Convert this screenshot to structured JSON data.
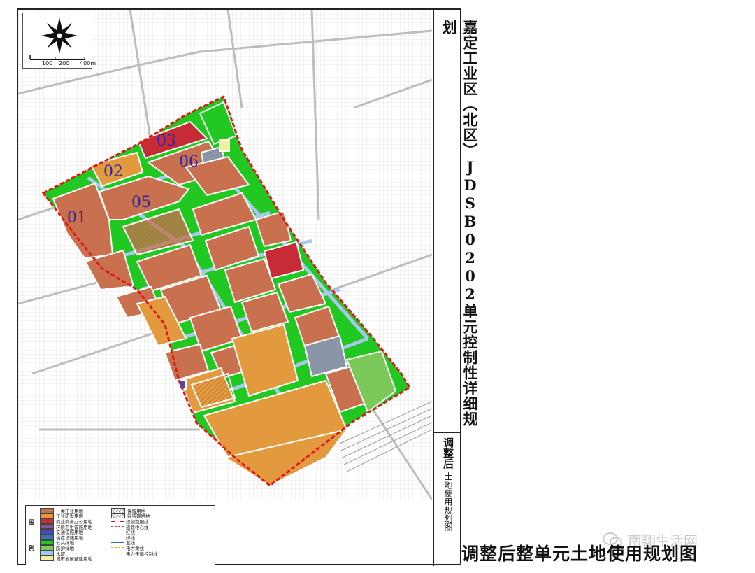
{
  "side_title": "嘉定工业区（北区）JDSB0202单元控制性详细规划",
  "side_subtitle": {
    "main": "调整后",
    "sub": "土地使用规划图"
  },
  "bottom_caption": "调整后整单元土地使用规划图",
  "watermark": "南翔生活网",
  "scale": {
    "labels": [
      "100",
      "200",
      "400m"
    ]
  },
  "parcel_labels": [
    "01",
    "02",
    "03",
    "05",
    "06"
  ],
  "legend": {
    "title_top": "图",
    "title_bottom": "例",
    "items_left": [
      {
        "label": "一类工业用地",
        "color": "#c9714f"
      },
      {
        "label": "工业研发用地",
        "color": "#e39a3e"
      },
      {
        "label": "商业商务办公用地",
        "color": "#c72b36"
      },
      {
        "label": "环境卫生设施用地",
        "color": "#7a5a99"
      },
      {
        "label": "交通设施用地",
        "color": "#4a4ab0"
      },
      {
        "label": "供应设施用地",
        "color": "#3b6fb7"
      },
      {
        "label": "公共绿地",
        "color": "#22c822"
      },
      {
        "label": "防护绿地",
        "color": "#7cc95b"
      },
      {
        "label": "水域",
        "color": "#a9c8ee"
      },
      {
        "label": "城市发展备建用地",
        "color": "#f0f0a0"
      }
    ],
    "items_right": [
      {
        "label": "保留用地",
        "type": "hatch"
      },
      {
        "label": "在待建用地",
        "type": "hatch"
      },
      {
        "label": "规划范围线",
        "type": "boundary"
      },
      {
        "label": "道路中心线",
        "type": "centerline"
      },
      {
        "label": "红线",
        "type": "redline"
      },
      {
        "label": "绿线",
        "type": "greenline"
      },
      {
        "label": "蓝线",
        "type": "blueline"
      },
      {
        "label": "电力黄线",
        "type": "yellowline"
      },
      {
        "label": "电力走廊控制线",
        "type": "corridor"
      }
    ]
  },
  "colors": {
    "industrial": "#c9714f",
    "rd": "#e39a3e",
    "commercial": "#c72b36",
    "green": "#22c822",
    "protect_green": "#7cc95b",
    "water": "#a9c8ee",
    "utility": "#8a95a8",
    "boundary": "#e01818"
  }
}
